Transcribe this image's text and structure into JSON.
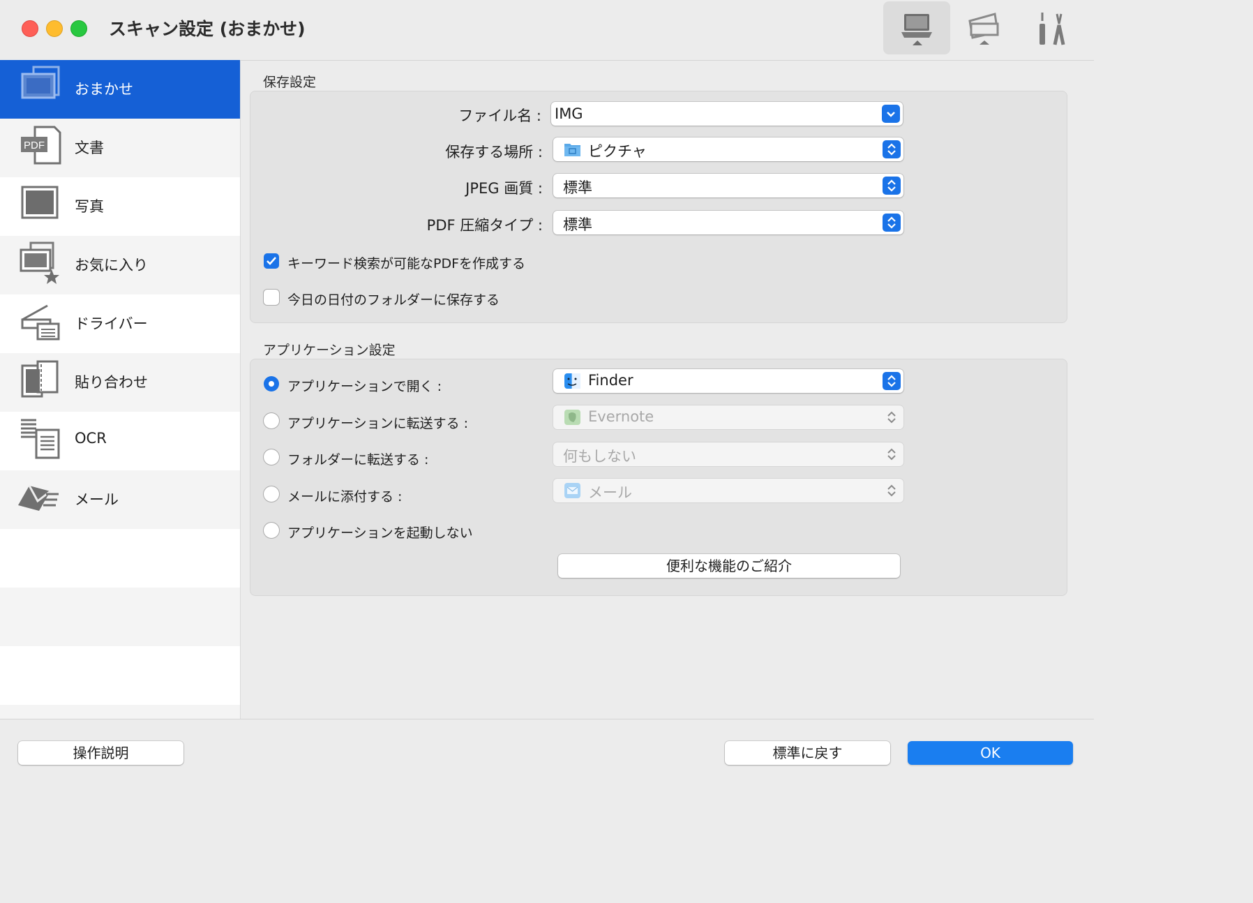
{
  "window": {
    "title": "スキャン設定 (おまかせ)",
    "toolbar": [
      {
        "name": "scan-from-computer",
        "icon": "computer-scan-icon",
        "active": true
      },
      {
        "name": "scan-from-operation-panel",
        "icon": "scanner-panel-icon",
        "active": false
      },
      {
        "name": "general-settings",
        "icon": "tools-icon",
        "active": false
      }
    ]
  },
  "sidebar": {
    "items": [
      {
        "label": "おまかせ",
        "icon": "auto-scan-icon",
        "selected": true
      },
      {
        "label": "文書",
        "icon": "pdf-document-icon",
        "selected": false
      },
      {
        "label": "写真",
        "icon": "photo-icon",
        "selected": false
      },
      {
        "label": "お気に入り",
        "icon": "favorite-icon",
        "selected": false
      },
      {
        "label": "ドライバー",
        "icon": "driver-icon",
        "selected": false
      },
      {
        "label": "貼り合わせ",
        "icon": "stitch-icon",
        "selected": false
      },
      {
        "label": "OCR",
        "icon": "ocr-icon",
        "selected": false
      },
      {
        "label": "メール",
        "icon": "mail-icon",
        "selected": false
      }
    ]
  },
  "save_settings": {
    "title": "保存設定",
    "file_name_label": "ファイル名 :",
    "file_name_value": "IMG",
    "location_label": "保存する場所 :",
    "location_value": "ピクチャ",
    "jpeg_label": "JPEG 画質 :",
    "jpeg_value": "標準",
    "pdf_label": "PDF 圧縮タイプ :",
    "pdf_value": "標準",
    "keyword_pdf_label": "キーワード検索が可能なPDFを作成する",
    "keyword_pdf_checked": true,
    "date_folder_label": "今日の日付のフォルダーに保存する",
    "date_folder_checked": false
  },
  "app_settings": {
    "title": "アプリケーション設定",
    "open_app_label": "アプリケーションで開く :",
    "open_app_value": "Finder",
    "send_app_label": "アプリケーションに転送する :",
    "send_app_value": "Evernote",
    "send_folder_label": "フォルダーに転送する :",
    "send_folder_value": "何もしない",
    "attach_mail_label": "メールに添付する :",
    "attach_mail_value": "メール",
    "no_launch_label": "アプリケーションを起動しない",
    "selected_option": "open_app",
    "features_button": "便利な機能のご紹介"
  },
  "footer": {
    "help_button": "操作説明",
    "defaults_button": "標準に戻す",
    "ok_button": "OK"
  },
  "colors": {
    "accent": "#1a73e8",
    "sidebar_selected": "#1560d6",
    "ok_button": "#1a7ef0"
  }
}
